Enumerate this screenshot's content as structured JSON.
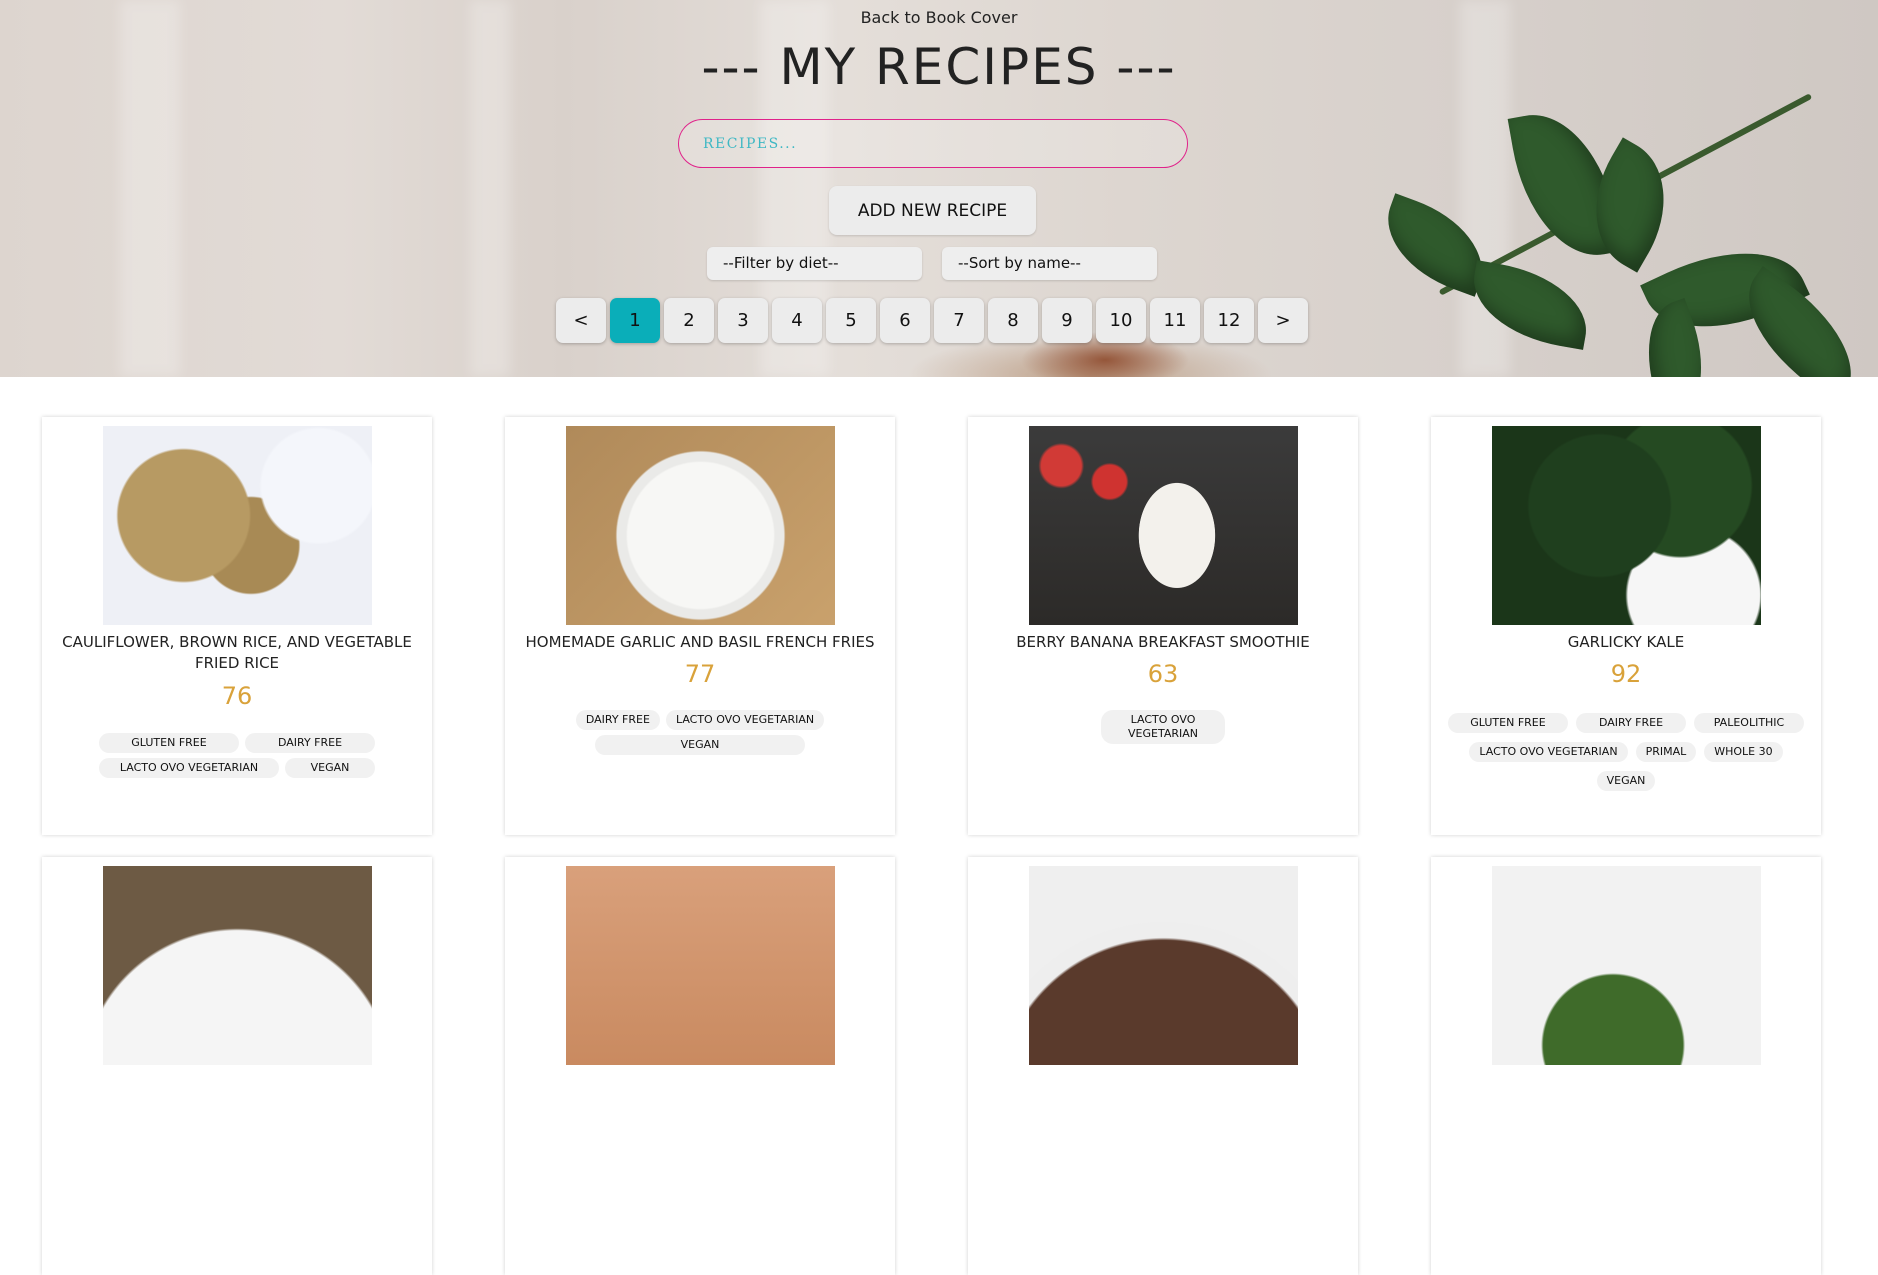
{
  "header": {
    "back_link": "Back to Book Cover",
    "title": "--- MY RECIPES ---",
    "search_placeholder": "RECIPES...",
    "add_button": "ADD NEW RECIPE",
    "filter_select": "--Filter by diet--",
    "sort_select": "--Sort by name--"
  },
  "pagination": {
    "prev": "<",
    "next": ">",
    "pages": [
      "1",
      "2",
      "3",
      "4",
      "5",
      "6",
      "7",
      "8",
      "9",
      "10",
      "11",
      "12"
    ],
    "active_page": "1"
  },
  "recipes": [
    {
      "name": "CAULIFLOWER, BROWN RICE, AND VEGETABLE FRIED RICE",
      "score": "76",
      "diets": [
        "GLUTEN FREE",
        "DAIRY FREE",
        "LACTO OVO VEGETARIAN",
        "VEGAN"
      ]
    },
    {
      "name": "HOMEMADE GARLIC AND BASIL FRENCH FRIES",
      "score": "77",
      "diets": [
        "DAIRY FREE",
        "LACTO OVO VEGETARIAN",
        "VEGAN"
      ]
    },
    {
      "name": "BERRY BANANA BREAKFAST SMOOTHIE",
      "score": "63",
      "diets": [
        "LACTO OVO VEGETARIAN"
      ]
    },
    {
      "name": "GARLICKY KALE",
      "score": "92",
      "diets": [
        "GLUTEN FREE",
        "DAIRY FREE",
        "PALEOLITHIC",
        "LACTO OVO VEGETARIAN",
        "PRIMAL",
        "WHOLE 30",
        "VEGAN"
      ]
    }
  ],
  "colors": {
    "accent_active_page": "#0aaeb9",
    "search_border": "#e0218a",
    "score": "#d9a23a"
  }
}
